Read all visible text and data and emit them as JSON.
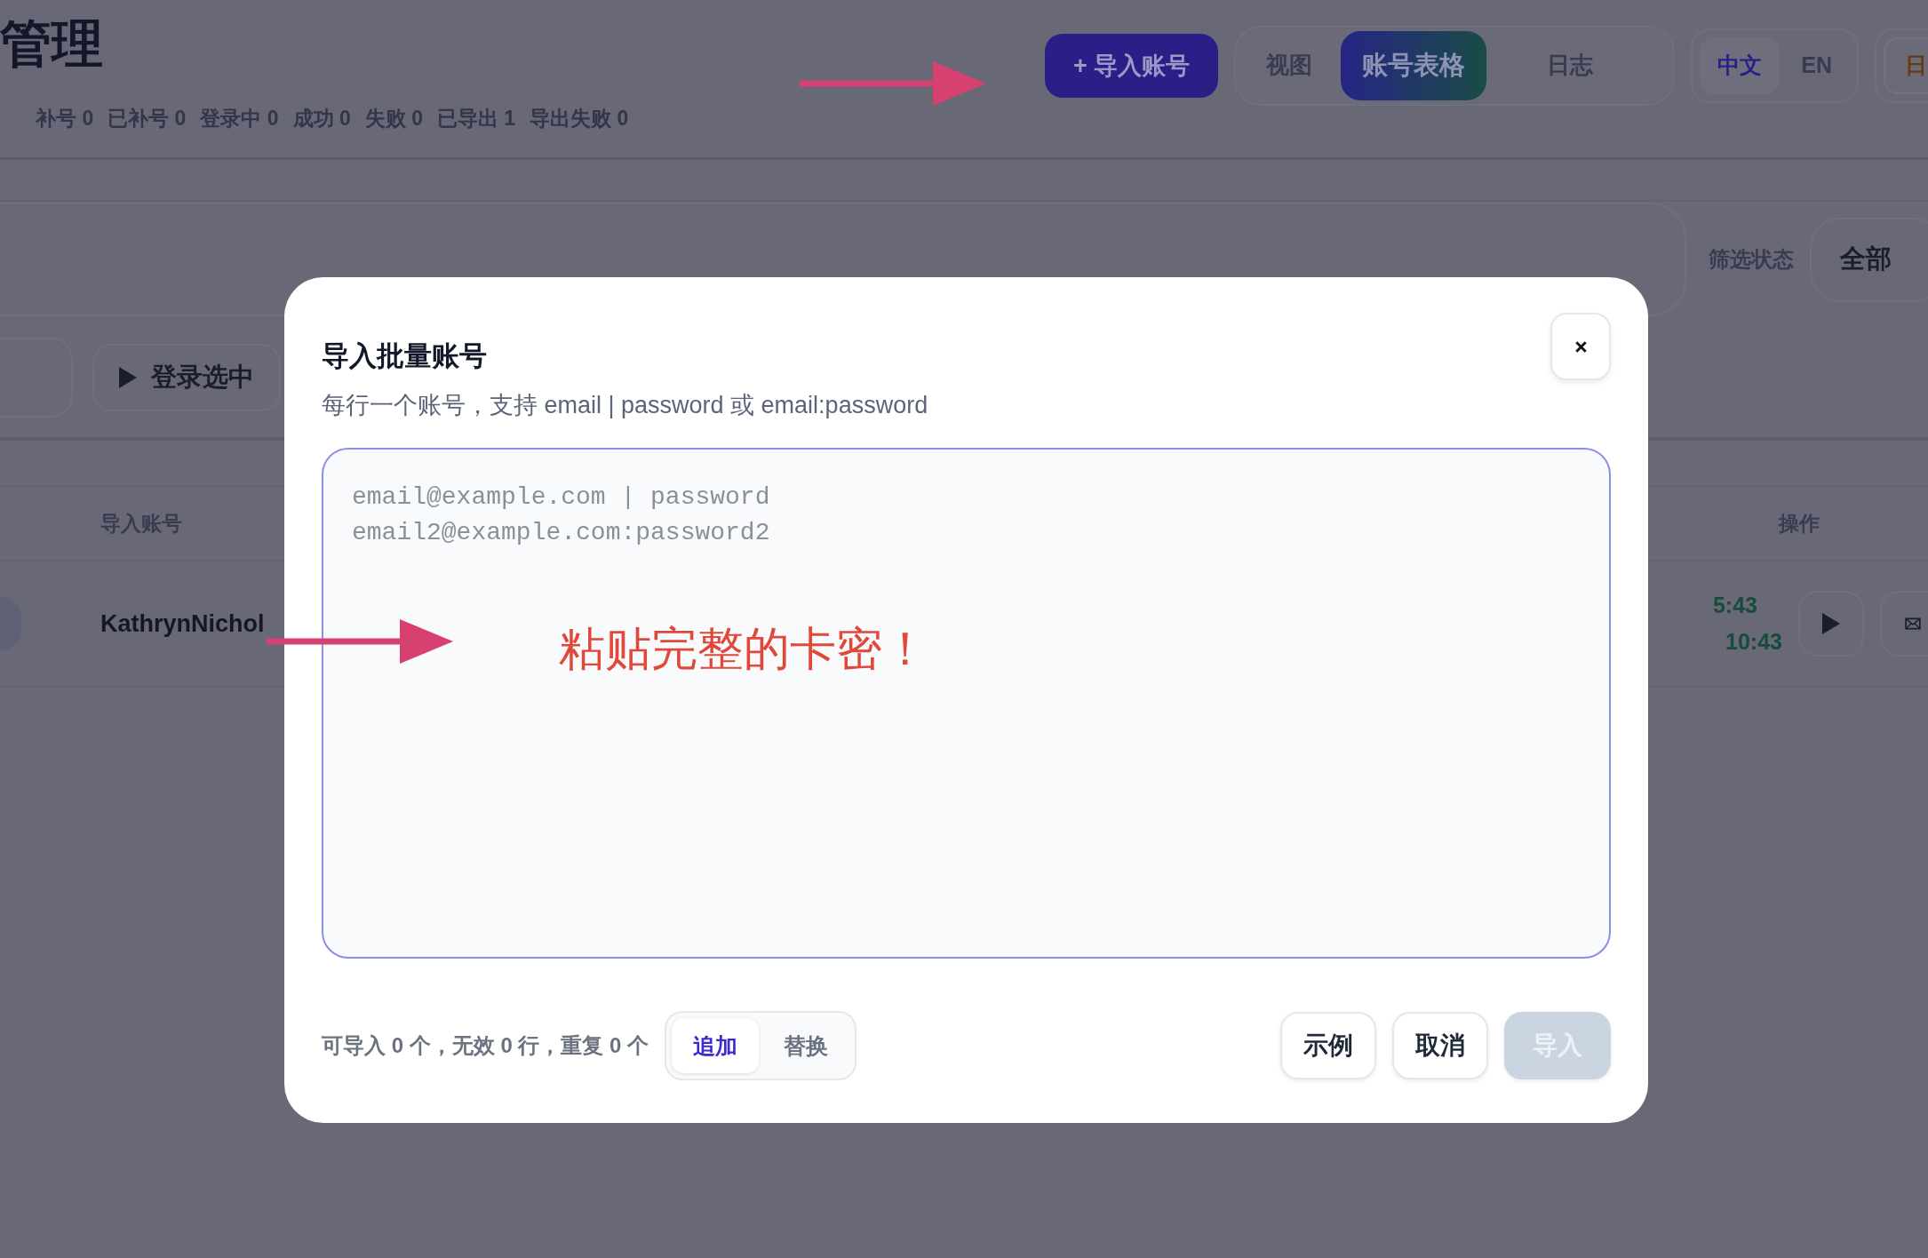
{
  "header": {
    "title": "管理",
    "stats": [
      "补号 0",
      "已补号 0",
      "登录中 0",
      "成功 0",
      "失败 0",
      "已导出 1",
      "导出失败 0"
    ],
    "import_button": "+ 导入账号",
    "view_tabs": [
      {
        "label": "视图",
        "selected": false
      },
      {
        "label": "账号表格",
        "selected": true
      },
      {
        "label": "日志",
        "selected": false
      }
    ],
    "languages": [
      {
        "label": "中文",
        "selected": true
      },
      {
        "label": "EN",
        "selected": false
      }
    ],
    "extra_button": "日"
  },
  "filter": {
    "label": "筛选状态",
    "value": "全部"
  },
  "toolbar": {
    "login_selected": "登录选中"
  },
  "table": {
    "columns": [
      "导入账号",
      "操作"
    ],
    "rows": [
      {
        "account": "KathrynNichol",
        "times": [
          "5:43",
          "10:43"
        ]
      }
    ]
  },
  "dialog": {
    "title": "导入批量账号",
    "subtitle": "每行一个账号，支持 email | password 或 email:password",
    "placeholder": "email@example.com | password\nemail2@example.com:password2",
    "annotation": "粘贴完整的卡密！",
    "summary": "可导入 **0** 个，无效 **0** 行，重复 **0** 个",
    "modes": [
      {
        "label": "追加",
        "selected": true
      },
      {
        "label": "替换",
        "selected": false
      }
    ],
    "buttons": [
      {
        "label": "示例",
        "disabled": false
      },
      {
        "label": "取消",
        "disabled": false
      },
      {
        "label": "导入",
        "disabled": true
      }
    ]
  }
}
